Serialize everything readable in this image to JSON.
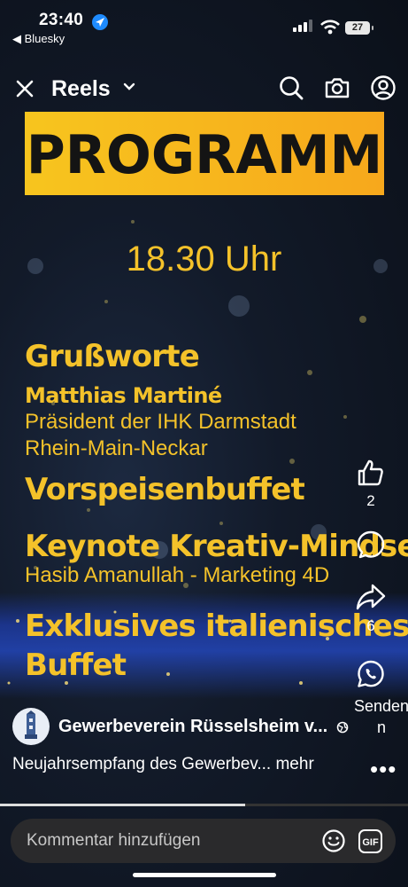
{
  "status_bar": {
    "time": "23:40",
    "back_app": "◀ Bluesky",
    "battery": "27"
  },
  "topbar": {
    "title": "Reels"
  },
  "poster": {
    "banner": "PROGRAMM",
    "time": "18.30 Uhr",
    "lines": [
      "Grußworte",
      "Matthias Martiné",
      "Präsident der IHK Darmstadt",
      "Rhein-Main-Neckar",
      "Vorspeisenbuffet",
      "Keynote Kreativ-Mindset",
      "Hasib Amanullah - Marketing 4D",
      "Exklusives italienisches",
      "Buffet"
    ]
  },
  "actions": {
    "likes": "2",
    "shares": "6",
    "send_line1": "Senden",
    "send_line2": "n"
  },
  "post": {
    "account": "Gewerbeverein Rüsselsheim v...",
    "description": "Neujahrsempfang des Gewerbev...",
    "more": "mehr",
    "progress": 0.6
  },
  "comment": {
    "placeholder": "Kommentar hinzufügen",
    "gif": "GIF"
  }
}
